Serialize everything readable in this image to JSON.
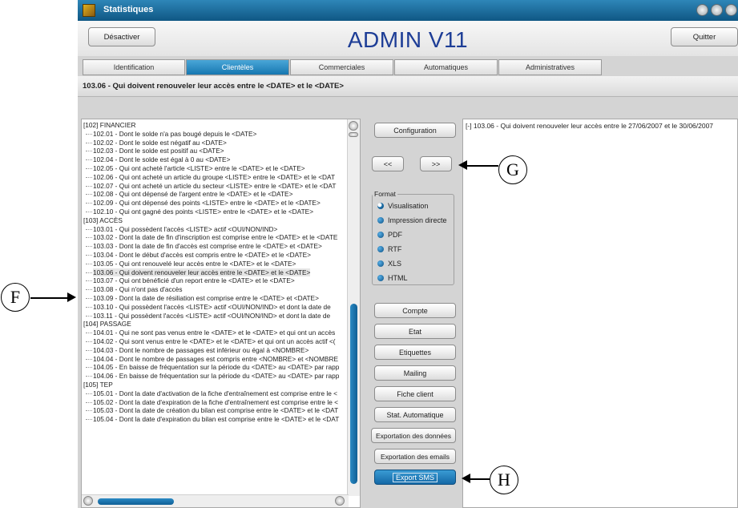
{
  "window": {
    "title": "Statistiques",
    "app_title": "ADMIN V11",
    "deactivate_label": "Désactiver",
    "quit_label": "Quitter",
    "titlebar_color": "#1a6ea3",
    "accent_color": "#1d3d96"
  },
  "tabs": [
    {
      "label": "Identification"
    },
    {
      "label": "Clientèles",
      "active": true
    },
    {
      "label": "Commerciales"
    },
    {
      "label": "Automatiques"
    },
    {
      "label": "Administratives"
    }
  ],
  "request_title": "103.06 - Qui doivent renouveler leur accès entre le <DATE> et le <DATE>",
  "tree": [
    {
      "label": "[102] FINANCIER",
      "cat": true
    },
    {
      "label": "102.01 - Dont le solde n'a pas bougé depuis le <DATE>"
    },
    {
      "label": "102.02 - Dont le solde est négatif au <DATE>"
    },
    {
      "label": "102.03 - Dont le solde est positif au <DATE>"
    },
    {
      "label": "102.04 - Dont le solde est égal à 0 au <DATE>"
    },
    {
      "label": "102.05 - Qui ont acheté l'article <LISTE> entre le <DATE> et le <DATE>"
    },
    {
      "label": "102.06 - Qui ont acheté un article du groupe <LISTE> entre le <DATE> et le <DAT"
    },
    {
      "label": "102.07 - Qui ont acheté un article du secteur <LISTE> entre le <DATE> et le <DAT"
    },
    {
      "label": "102.08 - Qui ont dépensé de l'argent entre le <DATE> et le <DATE>"
    },
    {
      "label": "102.09 - Qui ont dépensé des points <LISTE> entre le <DATE> et le <DATE>"
    },
    {
      "label": "102.10 - Qui ont gagné des points <LISTE> entre le <DATE> et le <DATE>"
    },
    {
      "label": "[103] ACCÈS",
      "cat": true
    },
    {
      "label": "103.01 - Qui possèdent l'accès <LISTE> actif <OUI/NON/IND>"
    },
    {
      "label": "103.02 - Dont la date de fin d'inscription est comprise entre le <DATE> et le <DATE"
    },
    {
      "label": "103.03 - Dont la date de fin d'accès est comprise entre le <DATE> et <DATE>"
    },
    {
      "label": "103.04 - Dont le début d'accès est compris entre le <DATE> et le <DATE>"
    },
    {
      "label": "103.05 - Qui ont renouvelé leur accès entre le <DATE> et le <DATE>"
    },
    {
      "label": "103.06 - Qui doivent renouveler leur accès entre le <DATE> et le <DATE>",
      "selected": true
    },
    {
      "label": "103.07 - Qui ont bénéficié d'un report entre le <DATE> et le <DATE>"
    },
    {
      "label": "103.08 - Qui n'ont pas d'accès"
    },
    {
      "label": "103.09 - Dont la date de résiliation est comprise entre le <DATE> et <DATE>"
    },
    {
      "label": "103.10 - Qui possèdent l'accès <LISTE> actif <OUI/NON/IND> et dont la date de"
    },
    {
      "label": "103.11 - Qui possèdent l'accès <LISTE> actif <OUI/NON/IND> et dont la date de"
    },
    {
      "label": "[104] PASSAGE",
      "cat": true
    },
    {
      "label": "104.01 - Qui ne sont pas venus entre le <DATE> et le <DATE> et qui ont un accès"
    },
    {
      "label": "104.02 - Qui sont venus entre le <DATE> et le <DATE> et qui ont un accès actif <("
    },
    {
      "label": "104.03 - Dont le nombre de passages est inférieur ou égal à <NOMBRE>"
    },
    {
      "label": "104.04 - Dont le nombre de passages est compris entre <NOMBRE> et <NOMBRE"
    },
    {
      "label": "104.05 - En baisse de fréquentation sur la période du <DATE> au <DATE> par rapp"
    },
    {
      "label": "104.06 - En baisse de fréquentation sur la période du <DATE> au <DATE> par rapp"
    },
    {
      "label": "[105] TEP",
      "cat": true
    },
    {
      "label": "105.01 - Dont la date d'activation de la fiche d'entraînement est comprise entre le <"
    },
    {
      "label": "105.02 - Dont la date d'expiration de la fiche d'entraînement est comprise entre le <"
    },
    {
      "label": "105.03 - Dont la date de création du bilan est comprise entre le <DATE> et le <DAT"
    },
    {
      "label": "105.04 - Dont la date d'expiration du bilan est comprise entre le <DATE> et le <DAT"
    }
  ],
  "buttons": {
    "configuration": "Configuration",
    "prev": "<<",
    "next": ">>",
    "compte": "Compte",
    "etat": "Etat",
    "etiquettes": "Etiquettes",
    "mailing": "Mailing",
    "fiche_client": "Fiche client",
    "stat_auto": "Stat. Automatique",
    "export_data": "Exportation des données",
    "export_emails": "Exportation des emails",
    "export_sms": "Export SMS"
  },
  "format": {
    "legend": "Format",
    "options": [
      {
        "label": "Visualisation",
        "selected": true
      },
      {
        "label": "Impression directe"
      },
      {
        "label": "PDF"
      },
      {
        "label": "RTF"
      },
      {
        "label": "XLS"
      },
      {
        "label": "HTML"
      }
    ]
  },
  "result_text": "[-] 103.06 - Qui doivent renouveler leur accès entre le 27/06/2007 et le 30/06/2007",
  "callouts": {
    "f": "F",
    "g": "G",
    "h": "H"
  }
}
